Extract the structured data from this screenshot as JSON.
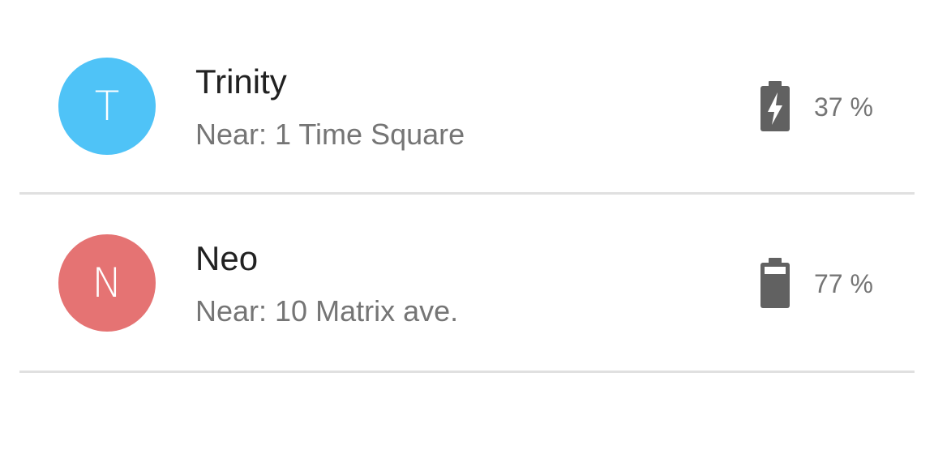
{
  "contacts": [
    {
      "initial": "T",
      "avatar_color": "#4fc3f7",
      "name": "Trinity",
      "location": "Near: 1 Time Square",
      "battery_text": "37 %",
      "battery_icon": "battery-charging-icon",
      "charging": true
    },
    {
      "initial": "N",
      "avatar_color": "#e57373",
      "name": "Neo",
      "location": "Near: 10 Matrix ave.",
      "battery_text": "77 %",
      "battery_icon": "battery-icon",
      "charging": false
    }
  ],
  "colors": {
    "divider": "#e0e0e0",
    "icon": "#616161",
    "primary_text": "#212121",
    "secondary_text": "#757575"
  }
}
